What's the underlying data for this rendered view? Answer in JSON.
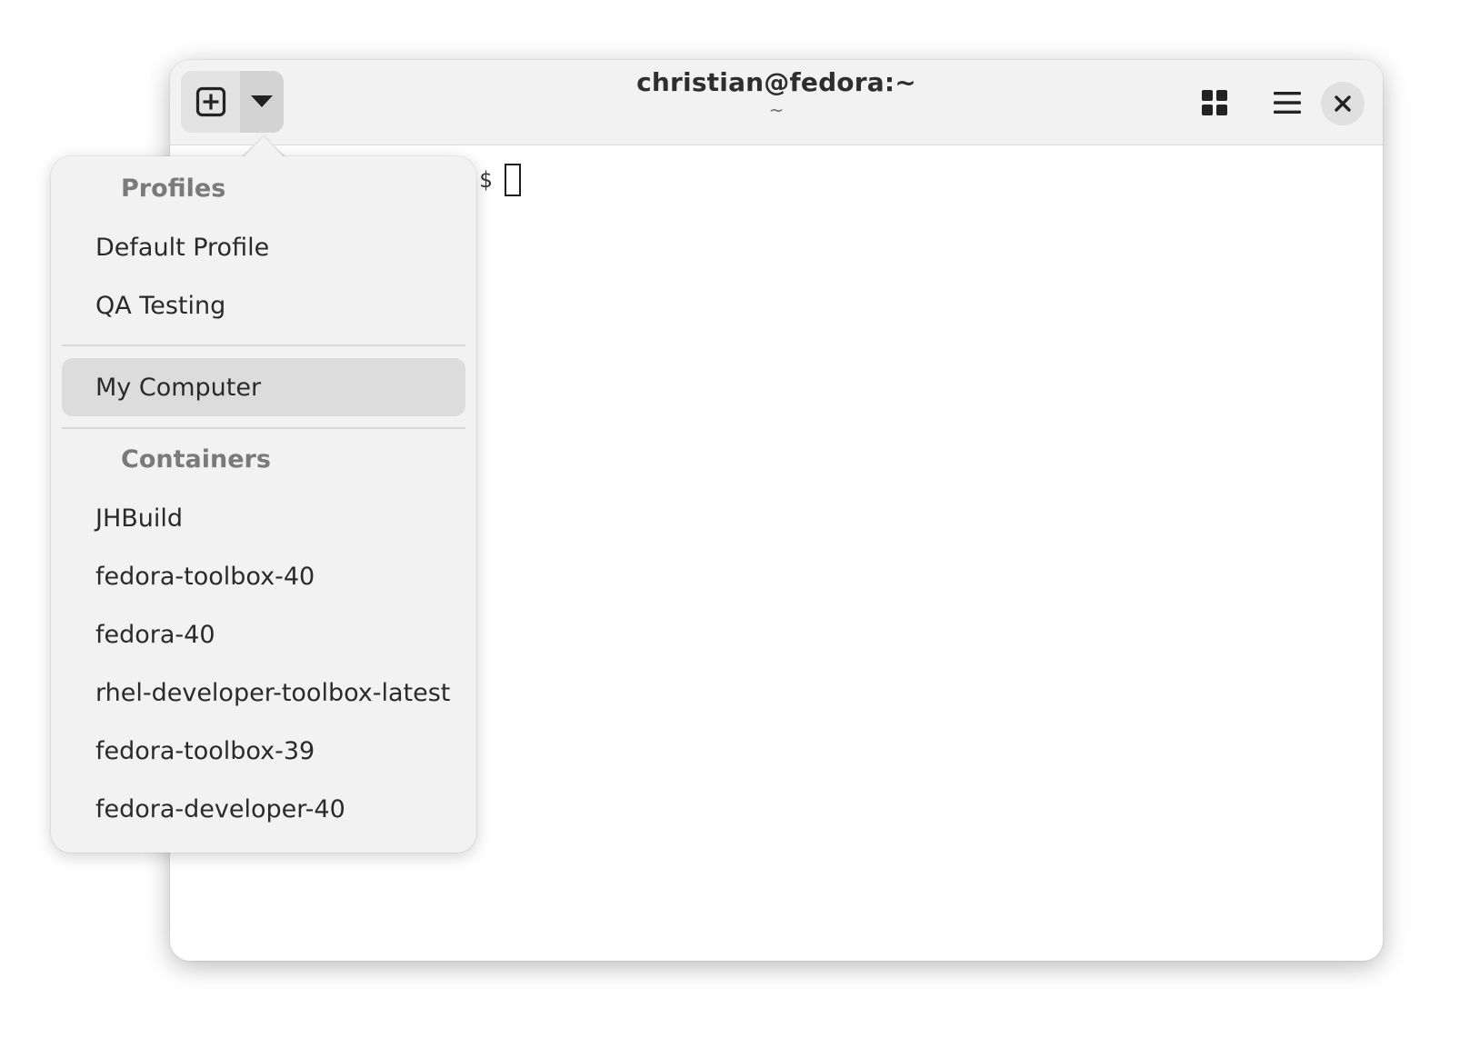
{
  "window": {
    "title": "christian@fedora:~",
    "subtitle": "~"
  },
  "headerbar": {
    "new_tab_icon": "plus-in-square-icon",
    "dropdown_icon": "triangle-down-icon",
    "overview_icon": "grid-icon",
    "menu_icon": "hamburger-icon",
    "close_icon": "close-icon"
  },
  "terminal": {
    "prompt": "$"
  },
  "popover": {
    "profiles_header": "Profiles",
    "profiles": [
      "Default Profile",
      "QA Testing"
    ],
    "host": "My Computer",
    "containers_header": "Containers",
    "containers": [
      "JHBuild",
      "fedora-toolbox-40",
      "fedora-40",
      "rhel-developer-toolbox-latest",
      "fedora-toolbox-39",
      "fedora-developer-40"
    ]
  },
  "colors": {
    "headerbar_bg": "#f2f2f2",
    "popover_bg": "#f2f2f2",
    "selected_item_bg": "#dcdcdc",
    "section_header": "#7a7a7a",
    "text": "#2a2a2a"
  }
}
